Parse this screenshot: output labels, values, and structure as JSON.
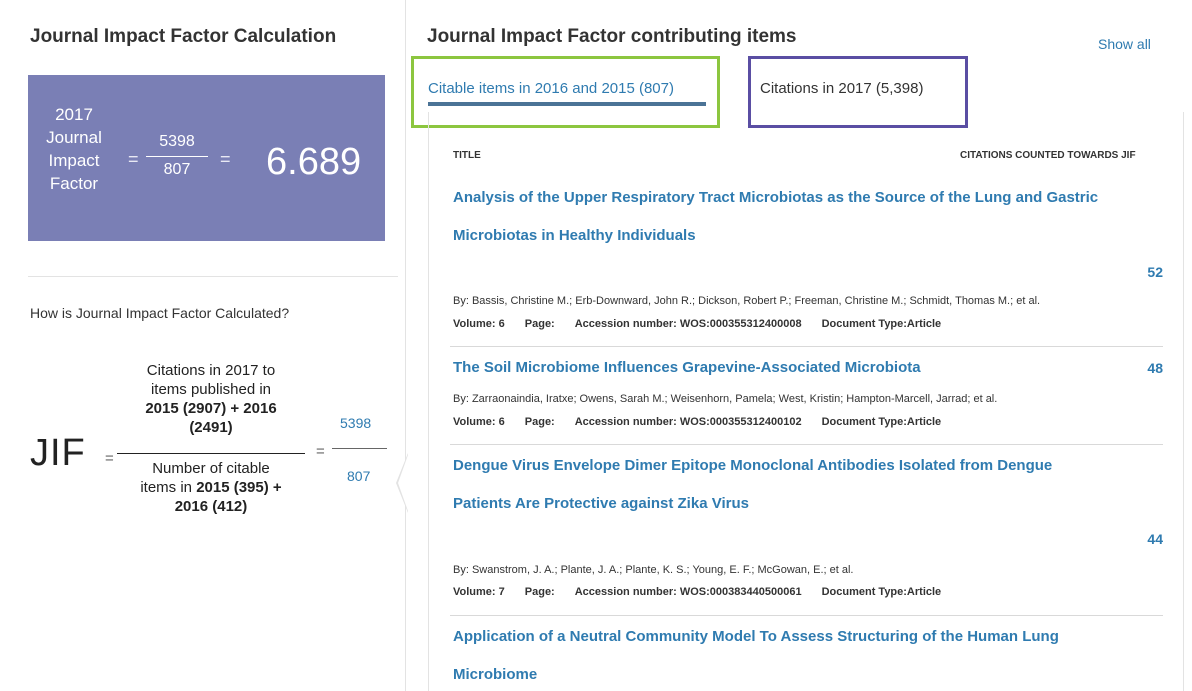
{
  "left": {
    "title": "Journal Impact Factor Calculation",
    "jif_box": {
      "label_line1": "2017",
      "label_line2": "Journal",
      "label_line3": "Impact",
      "label_line4": "Factor",
      "eq1": "=",
      "numerator": "5398",
      "denominator": "807",
      "eq2": "=",
      "value": "6.689"
    },
    "how_question": "How is Journal Impact Factor Calculated?",
    "formula": {
      "jif": "JIF",
      "eq1": "=",
      "num_line1": "Citations in 2017 to",
      "num_line2": "items published in",
      "num_line3": "2015 (2907) + 2016",
      "num_line4": "(2491)",
      "den_line1": "Number of citable",
      "den_line2_a": "items in ",
      "den_line2_b": "2015 (395) +",
      "den_line3": "2016 (412)",
      "eq2": "=",
      "right_num": "5398",
      "right_den": "807"
    }
  },
  "right": {
    "title": "Journal Impact Factor contributing items",
    "show_all": "Show all",
    "tabs": [
      {
        "label": "Citable items in 2016 and 2015 (807)",
        "active": true
      },
      {
        "label": "Citations in 2017 (5,398)",
        "active": false
      }
    ],
    "columns": {
      "title": "TITLE",
      "citations": "CITATIONS COUNTED TOWARDS JIF"
    },
    "items": [
      {
        "title_line1": "Analysis of the Upper Respiratory Tract Microbiotas as the Source of the Lung and Gastric",
        "title_line2": "Microbiotas in Healthy Individuals",
        "count": "52",
        "authors": "By: Bassis, Christine M.; Erb-Downward, John R.; Dickson, Robert P.; Freeman, Christine M.; Schmidt, Thomas M.; et al.",
        "volume": "Volume: 6",
        "page": "Page:",
        "accession": "Accession number: WOS:000355312400008",
        "doctype": "Document Type:Article"
      },
      {
        "title_line1": "The Soil Microbiome Influences Grapevine-Associated Microbiota",
        "count": "48",
        "authors": "By: Zarraonaindia, Iratxe; Owens, Sarah M.; Weisenhorn, Pamela; West, Kristin; Hampton-Marcell, Jarrad; et al.",
        "volume": "Volume: 6",
        "page": "Page:",
        "accession": "Accession number: WOS:000355312400102",
        "doctype": "Document Type:Article"
      },
      {
        "title_line1": "Dengue Virus Envelope Dimer Epitope Monoclonal Antibodies Isolated from Dengue",
        "title_line2": "Patients Are Protective against Zika Virus",
        "count": "44",
        "authors": "By: Swanstrom, J. A.; Plante, J. A.; Plante, K. S.; Young, E. F.; McGowan, E.; et al.",
        "volume": "Volume: 7",
        "page": "Page:",
        "accession": "Accession number: WOS:000383440500061",
        "doctype": "Document Type:Article"
      },
      {
        "title_line1": "Application of a Neutral Community Model To Assess Structuring of the Human Lung",
        "title_line2": "Microbiome"
      }
    ]
  },
  "colors": {
    "accent_link": "#2f7bb0",
    "jif_box_bg": "#7a7fb5",
    "highlight_green": "#8cc63f",
    "highlight_purple": "#5a4ea3",
    "tab_underline": "#4b7396"
  }
}
